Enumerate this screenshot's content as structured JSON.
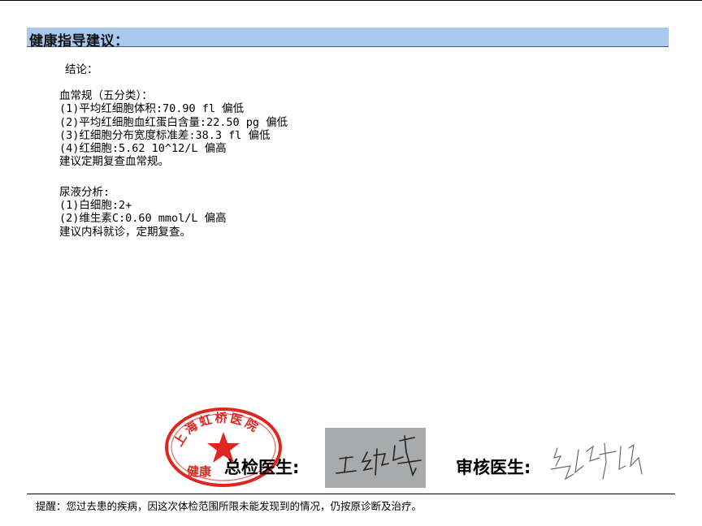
{
  "section": {
    "title": "健康指导建议："
  },
  "conclusion_label": "结论：",
  "report_blocks": [
    {
      "heading": "血常规（五分类）：",
      "items": [
        "(1)平均红细胞体积:70.90 fl 偏低",
        "(2)平均红细胞血红蛋白含量:22.50 pg 偏低",
        "(3)红细胞分布宽度标准差:38.3 fl 偏低",
        "(4)红细胞:5.62 10^12/L 偏高"
      ],
      "advice": "建议定期复查血常规。"
    },
    {
      "heading": "尿液分析:",
      "items": [
        "(1)白细胞:2+",
        "(2)维生素C:0.60 mmol/L 偏高"
      ],
      "advice": "建议内科就诊，定期复查。"
    }
  ],
  "signatures": {
    "chief_label": "总检医生:",
    "review_label": "审核医生:",
    "stamp_text": "上海虹桥医院",
    "stamp_bottom_text": "健康"
  },
  "footer": {
    "note": "提醒：您过去患的疾病，因这次体检范围所限未能发现到的情况，仍按原诊断及治疗。"
  },
  "colors": {
    "section_bar": "#a9c8ee",
    "stamp_red": "#e0271f",
    "signature_box": "#a9aaab"
  }
}
